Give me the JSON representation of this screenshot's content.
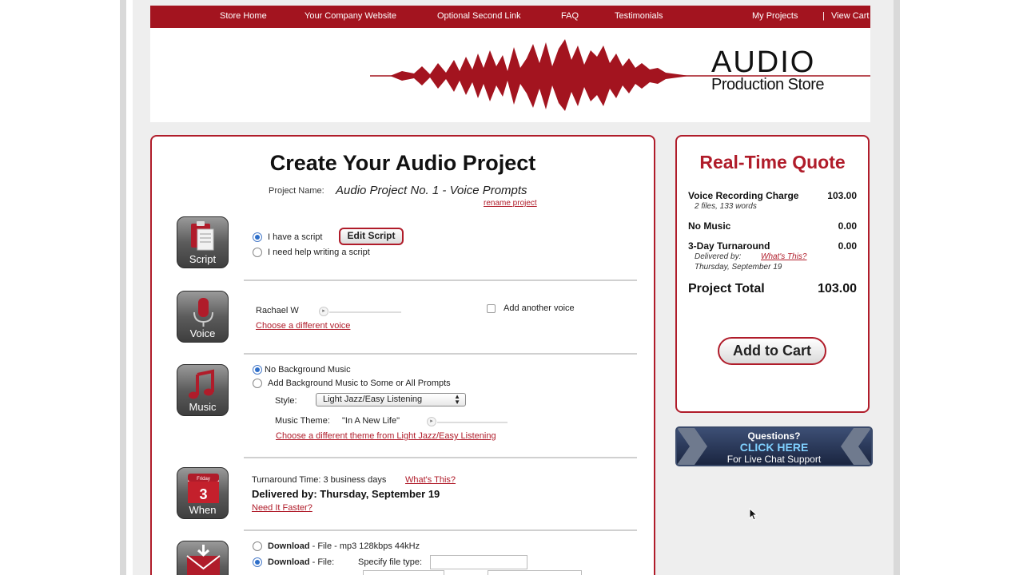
{
  "nav": {
    "store_home": "Store Home",
    "company_site": "Your Company Website",
    "second_link": "Optional Second Link",
    "faq": "FAQ",
    "testimonials": "Testimonials",
    "my_projects": "My Projects",
    "separator": "|",
    "view_cart": "View Cart"
  },
  "logo": {
    "line1": "AUDIO",
    "line2": "Production Store"
  },
  "project": {
    "title": "Create Your Audio Project",
    "name_label": "Project Name:",
    "name_value": "Audio Project No. 1 - Voice Prompts",
    "rename": "rename project"
  },
  "script": {
    "icon_label": "Script",
    "have_script": "I have a script",
    "edit_button": "Edit Script",
    "need_help": "I need help writing a script"
  },
  "voice": {
    "icon_label": "Voice",
    "voice_name": "Rachael W",
    "choose_voice": "Choose a different voice",
    "add_voice": "Add another voice"
  },
  "music": {
    "icon_label": "Music",
    "no_music": "No Background Music",
    "add_music": "Add Background Music to Some or All Prompts",
    "style_label": "Style:",
    "style_value": "Light Jazz/Easy Listening",
    "theme_label": "Music Theme:",
    "theme_value": "\"In A New Life\"",
    "choose_theme": "Choose a different theme from Light Jazz/Easy Listening"
  },
  "when": {
    "icon_day": "Friday",
    "icon_date": "3",
    "icon_label": "When",
    "turnaround": "Turnaround Time: 3 business days",
    "whats_this": "What's This?",
    "delivered": "Delivered by: Thursday, September 19",
    "faster": "Need It Faster?"
  },
  "delivery": {
    "opt1_bold": "Download",
    "opt1_rest": " - File - mp3 128kbps 44kHz",
    "opt2_bold": "Download",
    "opt2_rest": " - File:",
    "filetype_label": "Specify file type:"
  },
  "quote": {
    "title": "Real-Time Quote",
    "voice_label": "Voice Recording Charge",
    "voice_value": "103.00",
    "voice_sub": "2 files, 133 words",
    "music_label": "No Music",
    "music_value": "0.00",
    "turn_label": "3-Day Turnaround",
    "turn_value": "0.00",
    "delivered_by": "Delivered by:",
    "whats_this": "What's This?",
    "delivered_date": "Thursday, September 19",
    "total_label": "Project Total",
    "total_value": "103.00",
    "add_to_cart": "Add to Cart"
  },
  "chat": {
    "line1": "Questions?",
    "line2": "CLICK HERE",
    "line3": "For Live Chat Support"
  },
  "colors": {
    "brand_red": "#a3141f",
    "link_blue": "#2d6ec9"
  }
}
